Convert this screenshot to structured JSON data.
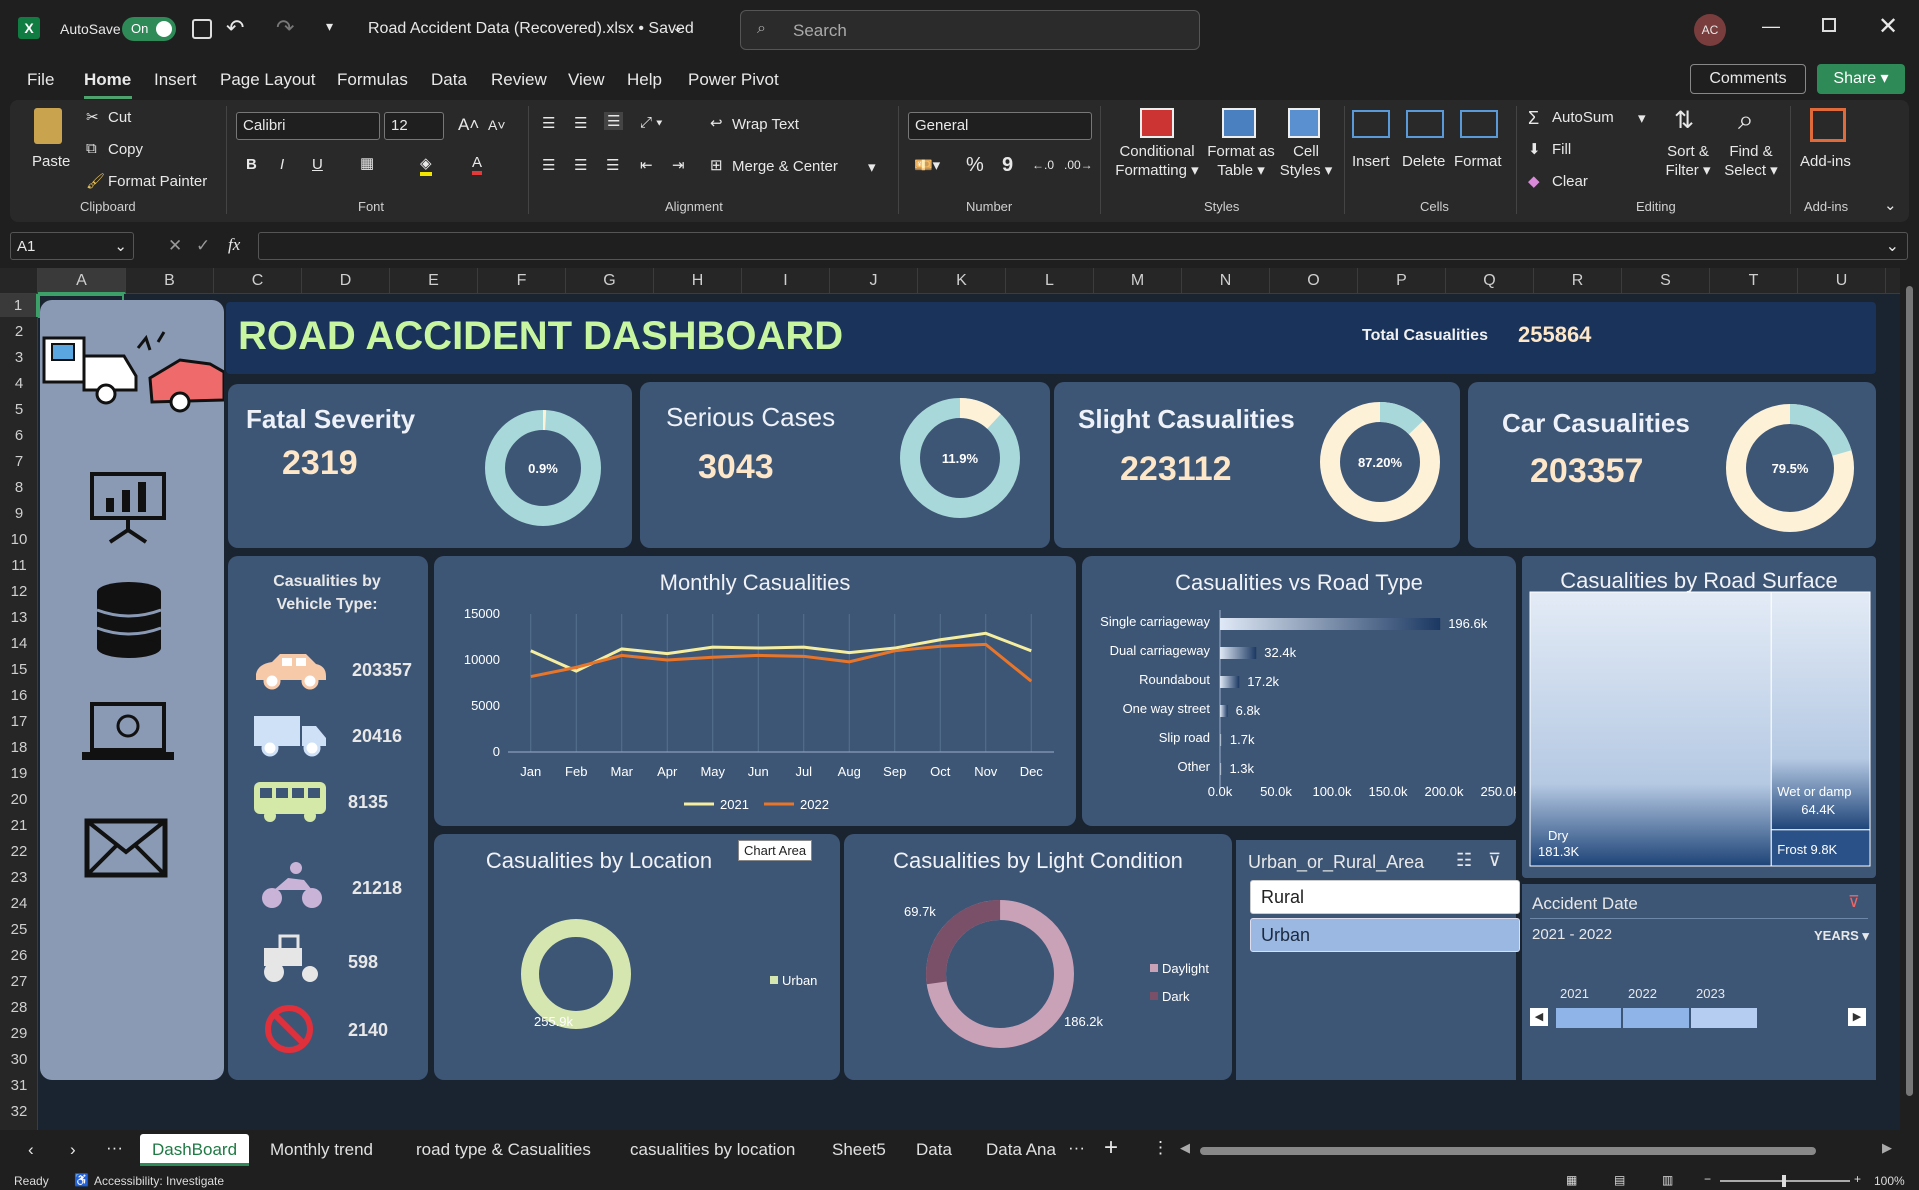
{
  "titlebar": {
    "autosave_label": "AutoSave",
    "toggle_state": "On",
    "file_title": "Road Accident Data (Recovered).xlsx • Saved",
    "search_placeholder": "Search",
    "avatar_initials": "AC"
  },
  "menu": {
    "items": [
      "File",
      "Home",
      "Insert",
      "Page Layout",
      "Formulas",
      "Data",
      "Review",
      "View",
      "Help",
      "Power Pivot"
    ],
    "active": "Home",
    "comments": "Comments",
    "share": "Share"
  },
  "ribbon": {
    "clipboard": {
      "paste": "Paste",
      "cut": "Cut",
      "copy": "Copy",
      "format_painter": "Format Painter",
      "label": "Clipboard"
    },
    "font": {
      "family": "Calibri",
      "size": "12",
      "label": "Font",
      "bold": "B",
      "italic": "I",
      "underline": "U"
    },
    "alignment": {
      "wrap": "Wrap Text",
      "merge": "Merge & Center",
      "label": "Alignment"
    },
    "number": {
      "format": "General",
      "percent": "%",
      "comma": "9",
      "label": "Number"
    },
    "styles": {
      "conditional": [
        "Conditional",
        "Formatting"
      ],
      "format_table": [
        "Format as",
        "Table"
      ],
      "cell_styles": [
        "Cell",
        "Styles"
      ],
      "label": "Styles"
    },
    "cells": {
      "insert": "Insert",
      "delete": "Delete",
      "format": "Format",
      "label": "Cells"
    },
    "editing": {
      "autosum": "AutoSum",
      "fill": "Fill",
      "clear": "Clear",
      "sort": [
        "Sort &",
        "Filter"
      ],
      "find": [
        "Find &",
        "Select"
      ],
      "label": "Editing"
    },
    "addins": {
      "button": "Add-ins",
      "label": "Add-ins"
    }
  },
  "formula": {
    "namebox": "A1",
    "fx": "fx",
    "content": ""
  },
  "columns": [
    "A",
    "B",
    "C",
    "D",
    "E",
    "F",
    "G",
    "H",
    "I",
    "J",
    "K",
    "L",
    "M",
    "N",
    "O",
    "P",
    "Q",
    "R",
    "S",
    "T",
    "U"
  ],
  "rows": [
    "1",
    "2",
    "3",
    "4",
    "5",
    "6",
    "7",
    "8",
    "9",
    "10",
    "11",
    "12",
    "13",
    "14",
    "15",
    "16",
    "17",
    "18",
    "19",
    "20",
    "21",
    "22",
    "23",
    "24",
    "25",
    "26",
    "27",
    "28",
    "29",
    "30",
    "31",
    "32"
  ],
  "dashboard": {
    "title": "ROAD ACCIDENT DASHBOARD",
    "total_label": "Total Casualities",
    "total_value": "255864",
    "kpis": [
      {
        "title": "Fatal Severity",
        "value": "2319",
        "pct_label": "0.9%",
        "pct": 0.9
      },
      {
        "title": "Serious Cases",
        "value": "3043",
        "pct_label": "11.9%",
        "pct": 11.9
      },
      {
        "title": "Slight Casualities",
        "value": "223112",
        "pct_label": "87.20%",
        "pct": 87.2
      },
      {
        "title": "Car Casualities",
        "value": "203357",
        "pct_label": "79.5%",
        "pct": 79.5
      }
    ],
    "vehicle": {
      "title": "Casualities by Vehicle Type:",
      "values": [
        "203357",
        "20416",
        "8135",
        "21218",
        "598",
        "2140"
      ],
      "icons": [
        "car-icon",
        "van-icon",
        "bus-icon",
        "motorcycle-icon",
        "tractor-icon",
        "no-entry-icon"
      ]
    },
    "colors": {
      "card": "#3e5676",
      "title_green": "#c8f5a0",
      "value_peach": "#fde7c8",
      "teal": "#a8d8da",
      "cream": "#fdf1d8",
      "line2021": "#f5eea0",
      "line2022": "#e8762a"
    }
  },
  "chart_data": [
    {
      "type": "line",
      "title": "Monthly Casualities",
      "x": [
        "Jan",
        "Feb",
        "Mar",
        "Apr",
        "May",
        "Jun",
        "Jul",
        "Aug",
        "Sep",
        "Oct",
        "Nov",
        "Dec"
      ],
      "series": [
        {
          "name": "2021",
          "values": [
            11000,
            8800,
            11200,
            10700,
            11400,
            11300,
            11400,
            10800,
            11300,
            12200,
            12900,
            11000
          ]
        },
        {
          "name": "2022",
          "values": [
            8200,
            9200,
            10500,
            10000,
            10300,
            10500,
            10400,
            9800,
            11000,
            11500,
            11700,
            7700
          ]
        }
      ],
      "yticks": [
        "0",
        "5000",
        "10000",
        "15000"
      ],
      "ylim": [
        0,
        15000
      ]
    },
    {
      "type": "bar",
      "title": "Casualities vs Road Type",
      "categories": [
        "Single carriageway",
        "Dual carriageway",
        "Roundabout",
        "One way street",
        "Slip road",
        "Other"
      ],
      "values": [
        196.6,
        32.4,
        17.2,
        6.8,
        1.7,
        1.3
      ],
      "labels": [
        "196.6k",
        "32.4k",
        "17.2k",
        "6.8k",
        "1.7k",
        "1.3k"
      ],
      "xticks": [
        "0.0k",
        "50.0k",
        "100.0k",
        "150.0k",
        "200.0k",
        "250.0k"
      ],
      "xlim": [
        0,
        250
      ]
    },
    {
      "type": "area",
      "title": "Casualities by Road Surface",
      "categories": [
        "Dry",
        "Wet or damp",
        "Frost"
      ],
      "values": [
        181.3,
        64.4,
        9.8
      ],
      "labels": [
        "181.3K",
        "64.4K",
        "9.8K"
      ]
    },
    {
      "type": "pie",
      "title": "Casualities by Location",
      "categories": [
        "Urban"
      ],
      "values": [
        255.9
      ],
      "labels": [
        "255.9k"
      ]
    },
    {
      "type": "pie",
      "title": "Casualities by Light Condition",
      "categories": [
        "Daylight",
        "Dark"
      ],
      "values": [
        186.2,
        69.7
      ],
      "labels": [
        "186.2k",
        "69.7k"
      ]
    }
  ],
  "tooltip": "Chart Area",
  "slicer": {
    "title": "Urban_or_Rural_Area",
    "items": [
      "Rural",
      "Urban"
    ],
    "selected": "Urban"
  },
  "timeline": {
    "title": "Accident Date",
    "range": "2021 - 2022",
    "unit": "YEARS",
    "years": [
      "2021",
      "2022",
      "2023"
    ]
  },
  "tabs": [
    "DashBoard",
    "Monthly trend",
    "road type & Casualities",
    "casualities by location",
    "Sheet5",
    "Data",
    "Data Ana"
  ],
  "status": {
    "ready": "Ready",
    "accessibility": "Accessibility: Investigate",
    "zoom": "100%"
  }
}
